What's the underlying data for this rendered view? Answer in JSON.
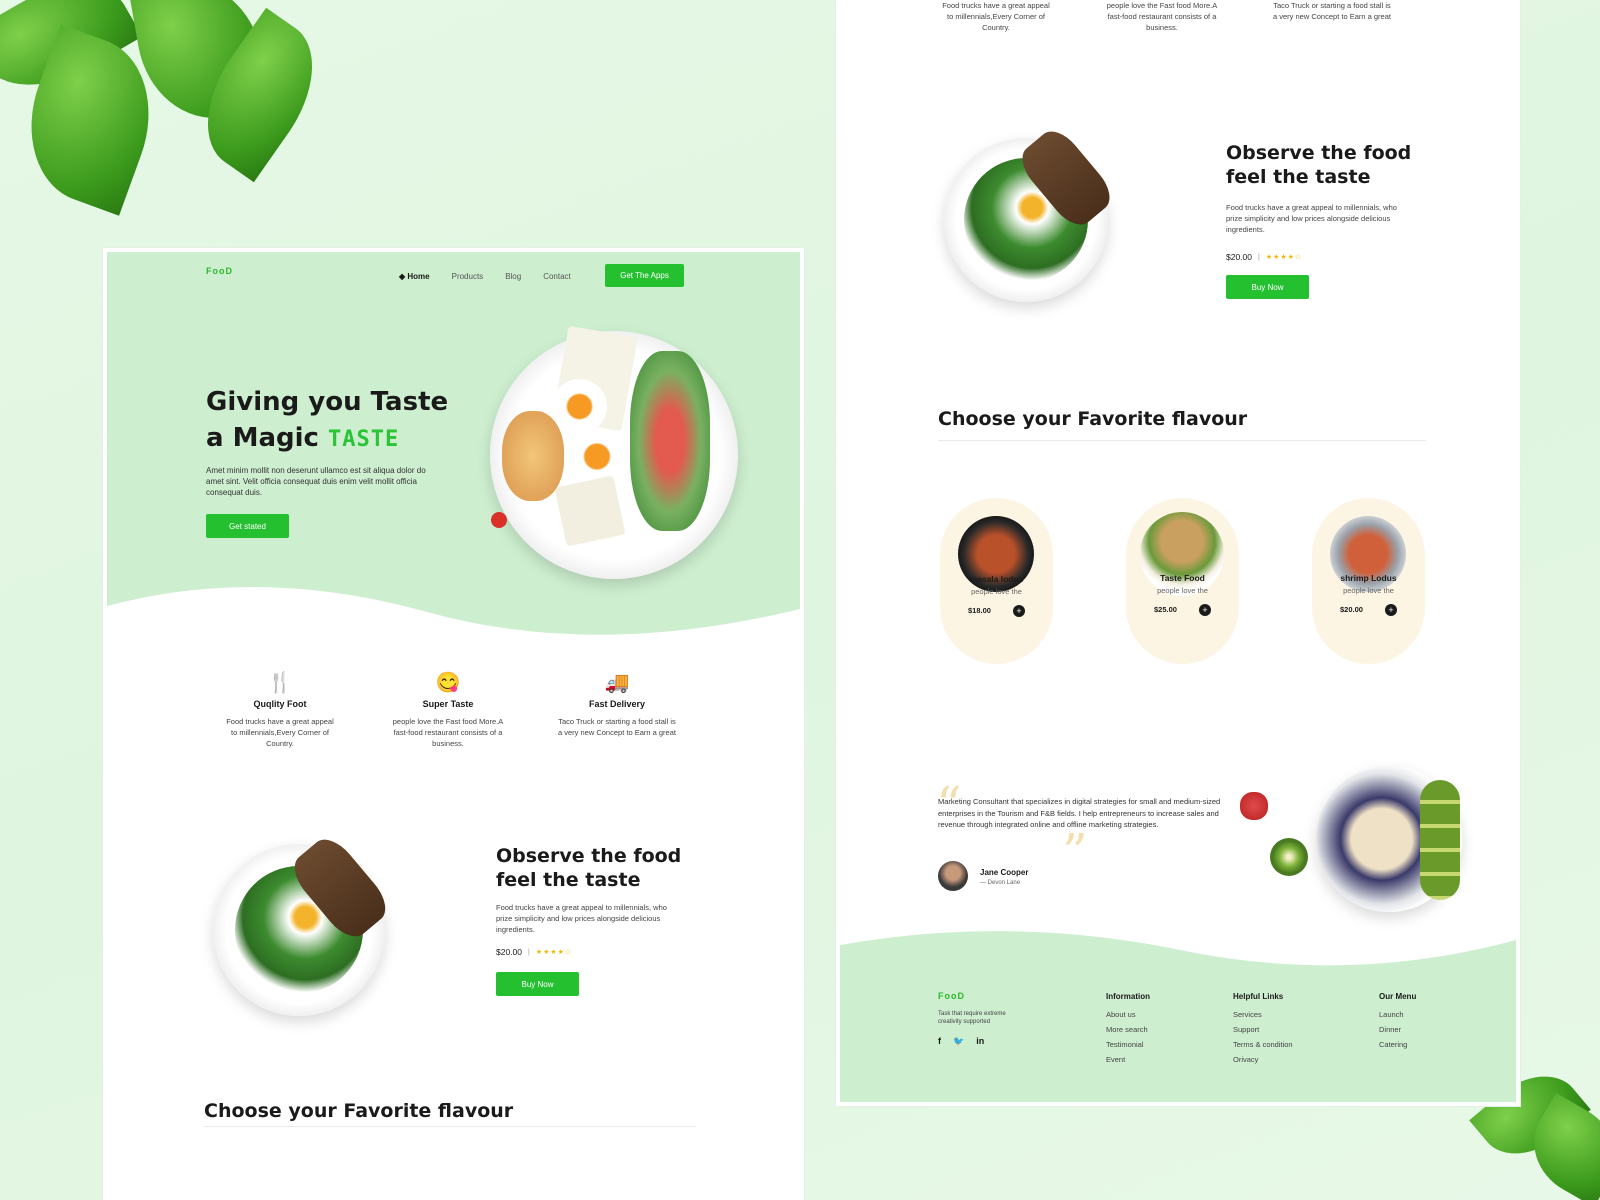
{
  "brand": {
    "logo": "FooD",
    "tagline": "Task that require extreme creativity supported",
    "green": "#24c030",
    "light_green": "#cdeecf",
    "cream": "#fdf5e4"
  },
  "nav": {
    "home": "Home",
    "products": "Products",
    "blog": "Blog",
    "contact": "Contact",
    "cta": "Get The Apps"
  },
  "hero": {
    "title_line1": "Giving you Taste",
    "title_line2": "a Magic",
    "accent": "TASTE",
    "desc": "Amet minim mollit non deserunt ullamco est sit aliqua dolor do amet sint. Velit officia consequat duis enim velit mollit officia consequat duis.",
    "button": "Get stated"
  },
  "features": [
    {
      "icon": "cutlery-icon",
      "glyph": "🍴",
      "title": "Quqlity Foot",
      "desc": "Food trucks have a great appeal to millennials,Every Corner of Country."
    },
    {
      "icon": "smiley-icon",
      "glyph": "😋",
      "title": "Super Taste",
      "desc": "people love the Fast food More.A fast-food restaurant consists of a business."
    },
    {
      "icon": "truck-icon",
      "glyph": "🚚",
      "title": "Fast Delivery",
      "desc": "Taco Truck or starting a food stall is a very new Concept to Earn a great"
    }
  ],
  "observe": {
    "title_line1": "Observe the food",
    "title_line2": "feel the taste",
    "desc": "Food trucks have a great appeal to millennials, who prize simplicity and low prices alongside delicious ingredients.",
    "price": "$20.00",
    "rating": "★★★★☆",
    "button": "Buy Now"
  },
  "choose": {
    "title": "Choose your Favorite flavour"
  },
  "products": [
    {
      "name": "masala lodus",
      "sub": "people love the",
      "price": "$18.00"
    },
    {
      "name": "Taste Food",
      "sub": "people love the",
      "price": "$25.00"
    },
    {
      "name": "shrimp Lodus",
      "sub": "people love the",
      "price": "$20.00"
    }
  ],
  "testimonial": {
    "text": "Marketing Consultant that specializes in digital strategies for small and medium-sized enterprises in the Tourism and F&B fields. I help entrepreneurs to increase sales and revenue through integrated online and offline marketing strategies.",
    "name": "Jane Cooper",
    "role": "— Devon Lane"
  },
  "footer": {
    "social": [
      "f",
      "t",
      "in"
    ],
    "information": {
      "title": "Information",
      "links": [
        "About us",
        "More search",
        "Testimonial",
        "Event"
      ]
    },
    "helpful": {
      "title": "Helpful Links",
      "links": [
        "Services",
        "Support",
        "Terms & condition",
        "Orivacy"
      ]
    },
    "menu": {
      "title": "Our Menu",
      "links": [
        "Launch",
        "Dinner",
        "Catering"
      ]
    }
  }
}
